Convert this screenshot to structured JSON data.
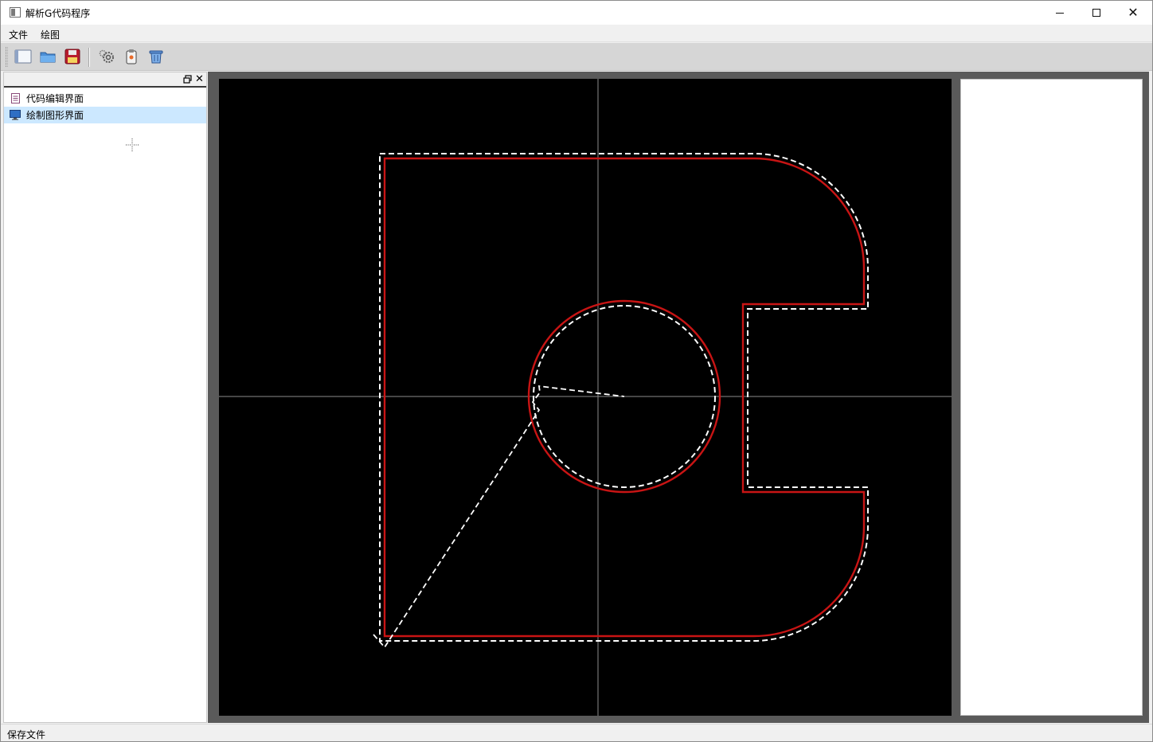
{
  "window": {
    "title": "解析G代码程序",
    "icon": "app-window-icon"
  },
  "menu": {
    "file": "文件",
    "draw": "绘图"
  },
  "toolbar": {
    "buttons": [
      "new-file-icon",
      "open-folder-icon",
      "save-icon",
      "settings-gears-icon",
      "clipboard-icon",
      "delete-bin-icon"
    ]
  },
  "sidebar": {
    "items": [
      {
        "label": "代码编辑界面",
        "icon": "document-icon",
        "selected": false
      },
      {
        "label": "绘制图形界面",
        "icon": "monitor-icon",
        "selected": true
      }
    ]
  },
  "canvas": {
    "background": "#000000",
    "axis_color": "#8c8c8c",
    "contour_color": "#c81414",
    "toolpath_color": "#ffffff"
  },
  "status": {
    "text": "保存文件"
  }
}
